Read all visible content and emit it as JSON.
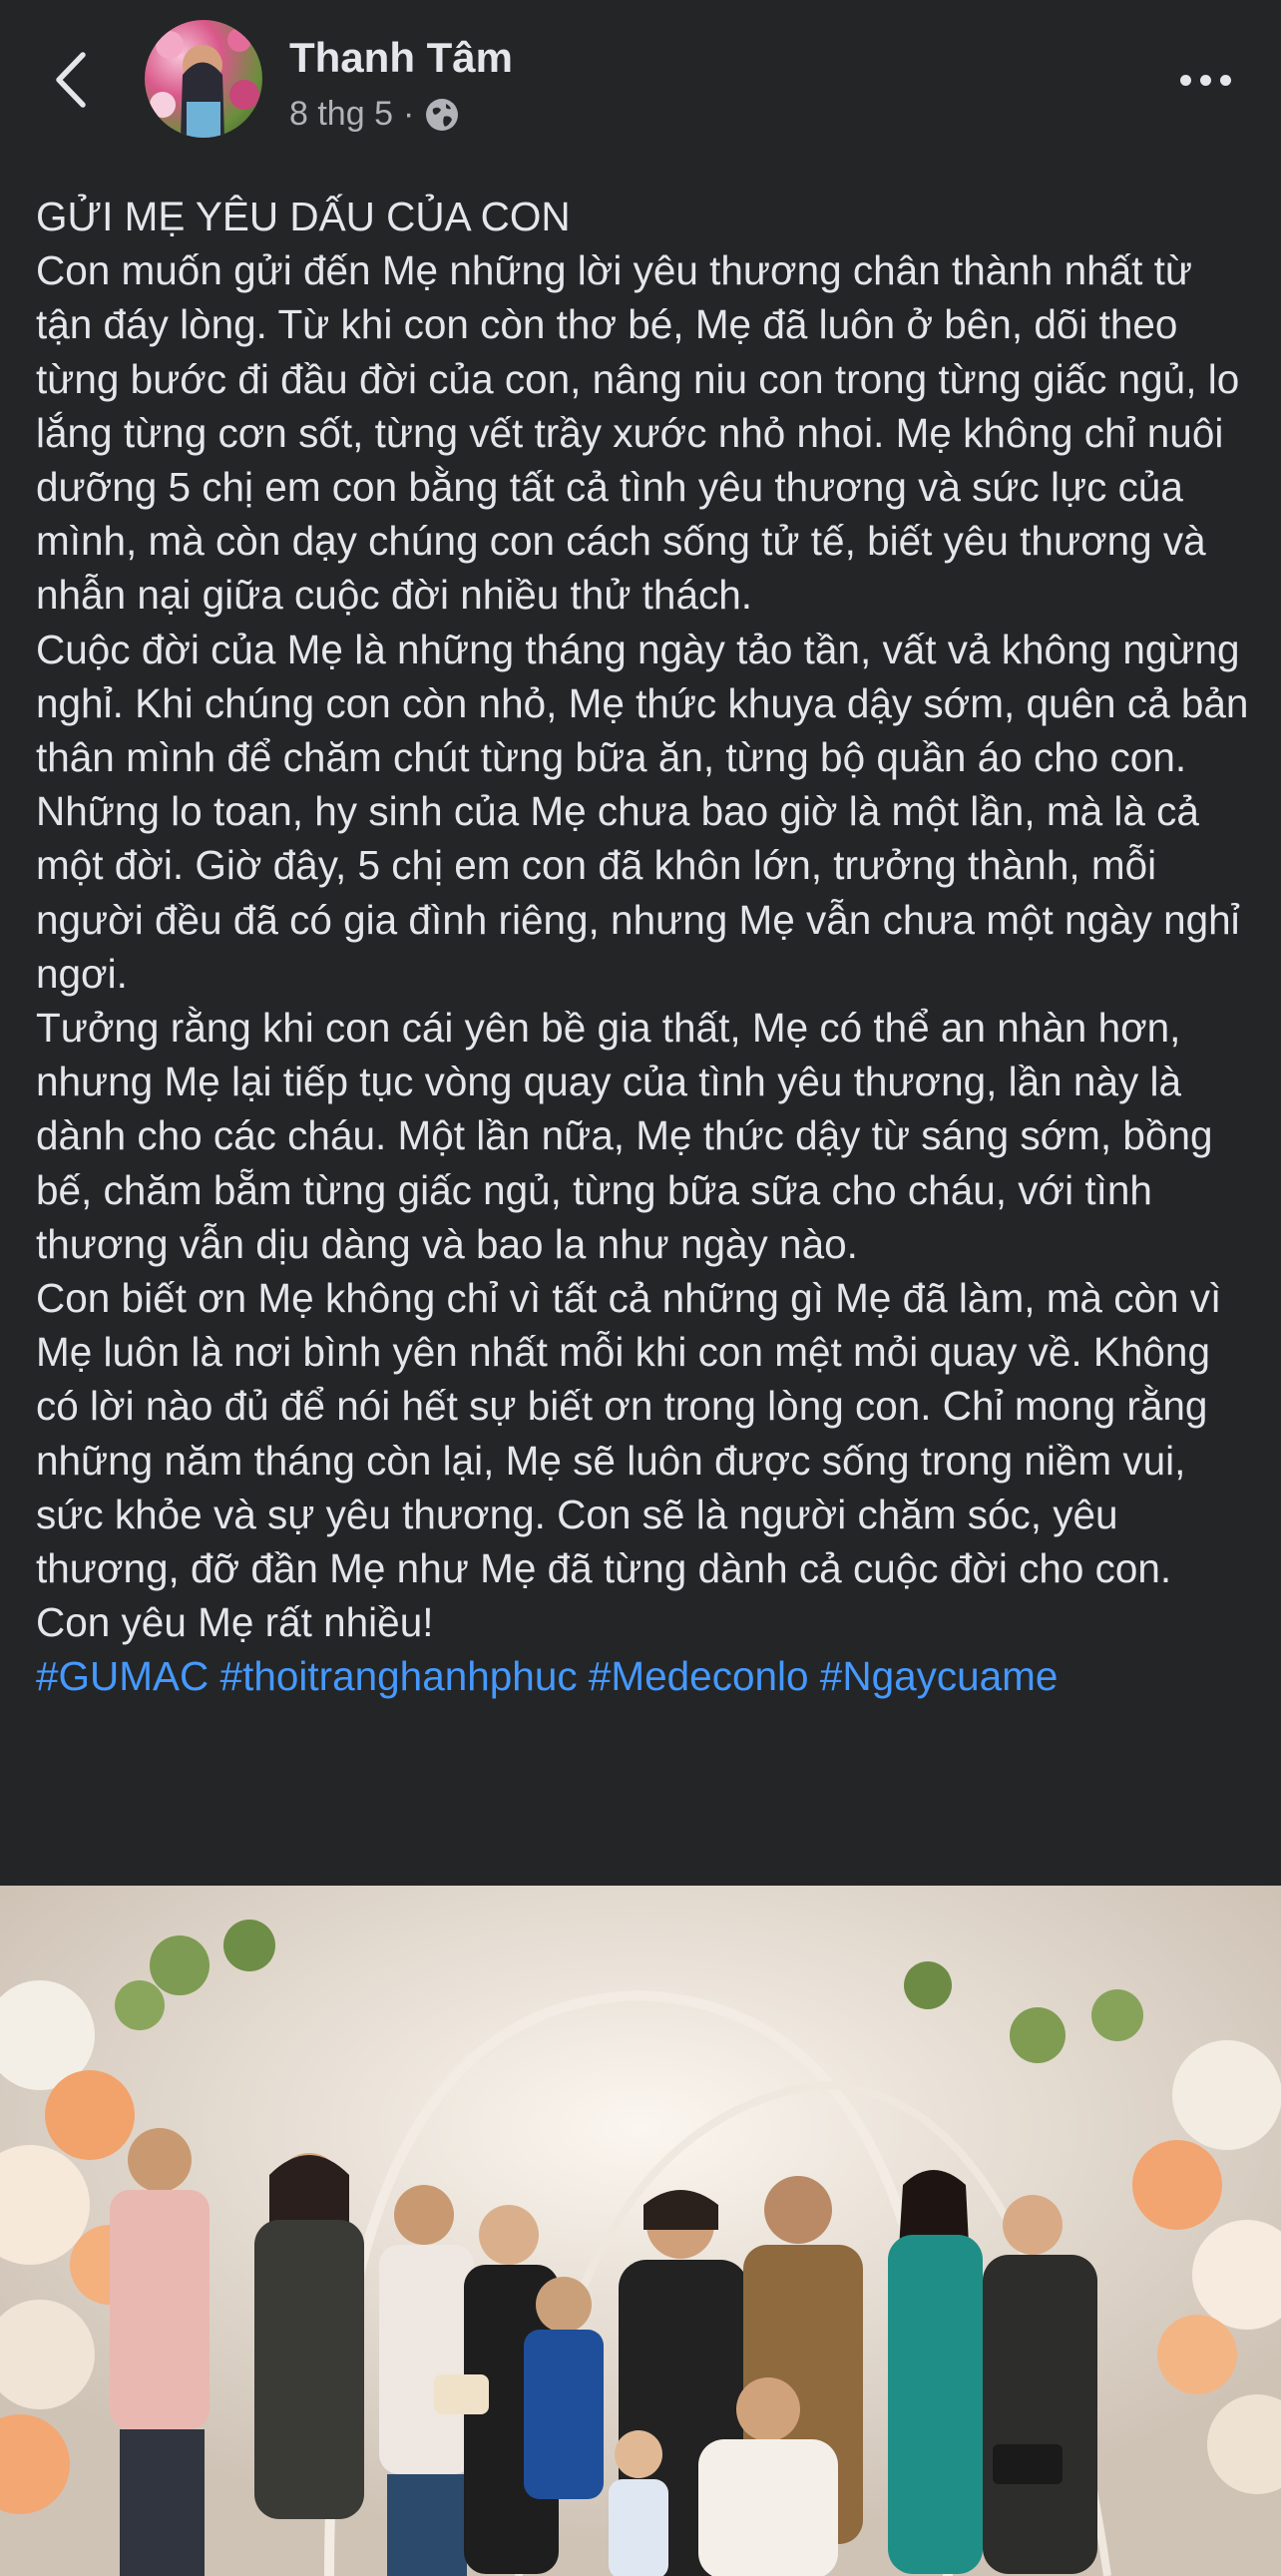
{
  "header": {
    "back_icon": "chevron-left-icon",
    "author_name": "Thanh Tâm",
    "timestamp": "8 thg 5",
    "separator": "·",
    "audience_icon": "globe-icon",
    "more_icon": "more-horizontal-icon"
  },
  "post": {
    "title": "GỬI MẸ YÊU DẤU CỦA CON",
    "paragraphs": [
      "Con muốn gửi đến Mẹ những lời yêu thương chân thành nhất từ tận đáy lòng. Từ khi con còn thơ bé, Mẹ đã luôn ở bên, dõi theo từng bước đi đầu đời của con, nâng niu con trong từng giấc ngủ, lo lắng từng cơn sốt, từng vết trầy xước nhỏ nhoi. Mẹ không chỉ nuôi dưỡng 5 chị em con bằng tất cả tình yêu thương và sức lực của mình, mà còn dạy chúng con cách sống tử tế, biết yêu thương và nhẫn nại giữa cuộc đời nhiều thử thách.",
      "Cuộc đời của Mẹ là những tháng ngày tảo tần, vất vả không ngừng nghỉ. Khi chúng con còn nhỏ, Mẹ thức khuya dậy sớm, quên cả bản thân mình để chăm chút từng bữa ăn, từng bộ quần áo cho con. Những lo toan, hy sinh của Mẹ chưa bao giờ là một lần, mà là cả một đời. Giờ đây, 5 chị em con đã khôn lớn, trưởng thành, mỗi người đều đã có gia đình riêng, nhưng Mẹ vẫn chưa một ngày nghỉ ngơi.",
      "Tưởng rằng khi con cái yên bề gia thất, Mẹ có thể an nhàn hơn, nhưng Mẹ lại tiếp tục vòng quay của tình yêu thương, lần này là dành cho các cháu. Một lần nữa, Mẹ thức dậy từ sáng sớm, bồng bế, chăm bẵm từng giấc ngủ, từng bữa sữa cho cháu, với tình thương vẫn dịu dàng và bao la như ngày nào.",
      "Con biết ơn Mẹ không chỉ vì tất cả những gì Mẹ đã làm, mà còn vì Mẹ luôn là nơi bình yên nhất mỗi khi con mệt mỏi quay về. Không có lời nào đủ để nói hết sự biết ơn trong lòng con. Chỉ mong rằng những năm tháng còn lại, Mẹ sẽ luôn được sống trong niềm vui, sức khỏe và sự yêu thương. Con sẽ là người chăm sóc, yêu thương, đỡ đần Mẹ như Mẹ đã từng dành cả cuộc đời cho con.",
      "Con yêu Mẹ rất nhiều!"
    ],
    "hashtags": [
      "#GUMAC",
      "#thoitranghanhphuc",
      "#Medeconlo",
      "#Ngaycuame"
    ]
  },
  "photo": {
    "description_icon": "family-photo-image",
    "colors": {
      "background": "#242526",
      "text": "#e4e6eb",
      "meta": "#b0b3b8",
      "link": "#4599ff"
    }
  }
}
